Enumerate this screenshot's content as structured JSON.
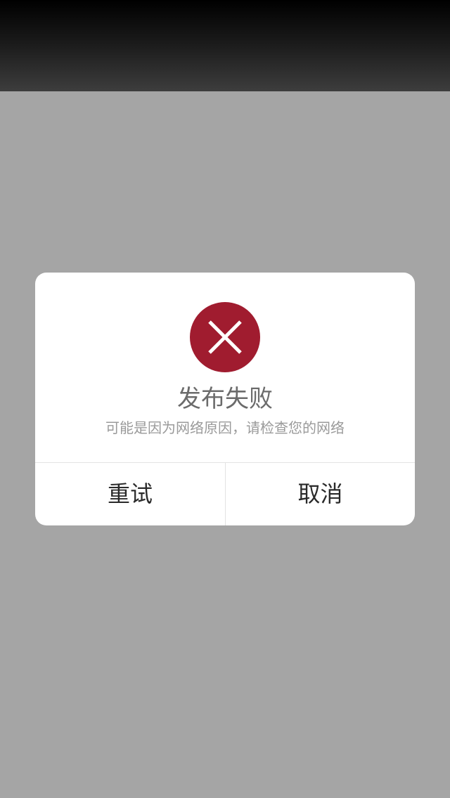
{
  "dialog": {
    "icon": "error-x-icon",
    "title": "发布失败",
    "message": "可能是因为网络原因，请检查您的网络",
    "retry_label": "重试",
    "cancel_label": "取消"
  },
  "colors": {
    "error_icon_bg": "#a01c2f",
    "backdrop": "#a5a5a5",
    "dialog_bg": "#ffffff"
  }
}
